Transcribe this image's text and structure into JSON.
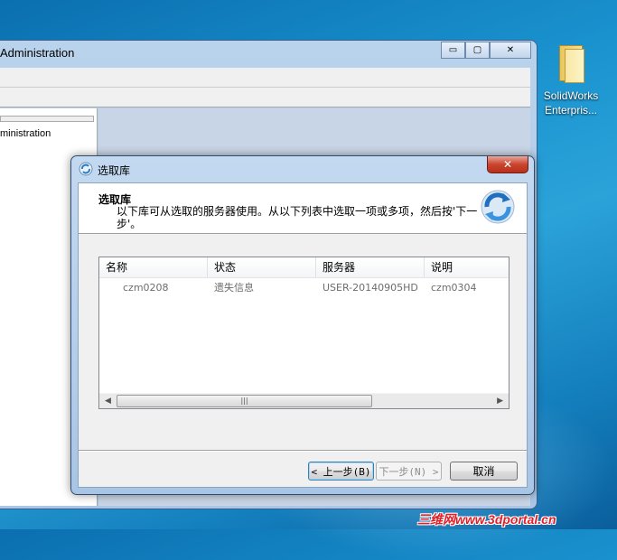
{
  "background_window": {
    "title": "Administration",
    "tree_item": "ministration",
    "controls": {
      "minimize": "▭",
      "maximize": "▢",
      "close": "✕"
    }
  },
  "desktop_icon": {
    "label_line1": "SolidWorks",
    "label_line2": "Enterpris..."
  },
  "dialog": {
    "title": "选取库",
    "close_label": "✕",
    "header": {
      "heading": "选取库",
      "description": "以下库可从选取的服务器使用。从以下列表中选取一项或多项，然后按'下一步'。"
    },
    "list": {
      "columns": [
        "名称",
        "状态",
        "服务器",
        "说明"
      ],
      "rows": [
        [
          "czm0208",
          "遗失信息",
          "USER-20140905HD",
          "czm0304"
        ]
      ],
      "scroll_left": "◀",
      "scroll_right": "▶",
      "thumb_grip": "|||"
    },
    "buttons": {
      "prev": "< 上一步(B)",
      "next": "下一步(N) >",
      "cancel": "取消"
    }
  },
  "watermark": "三维网www.3dportal.cn",
  "colors": {
    "desktop_blue": "#1a93cf",
    "close_red": "#c9452f",
    "watermark_red": "#e41e26"
  }
}
